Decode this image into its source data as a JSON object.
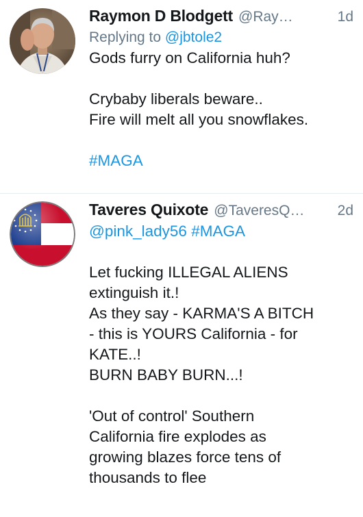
{
  "tweets": [
    {
      "display_name": "Raymon D Blodgett",
      "handle": "@Ray…",
      "time": "1d",
      "replying_to_prefix": "Replying to",
      "replying_to_handle": "@jbtole2",
      "lines": [
        "Gods furry on California huh?",
        "Crybaby liberals beware..",
        "Fire will melt all you snowflakes.",
        "#MAGA"
      ]
    },
    {
      "display_name": "Taveres Quixote",
      "handle": "@TaveresQ…",
      "time": "2d",
      "mention": "@pink_lady56",
      "hashtag": "#MAGA",
      "lines": [
        "Let fucking ILLEGAL ALIENS",
        "extinguish it.!",
        "As they say - KARMA'S A BITCH",
        "- this is YOURS California - for",
        "KATE..!",
        "BURN BABY BURN...!",
        "'Out of control' Southern",
        "California fire explodes as",
        "growing blazes force tens of",
        "thousands to flee"
      ]
    }
  ],
  "colors": {
    "link": "#1b95e0",
    "secondary_text": "#657786",
    "primary_text": "#14171a",
    "divider": "#e6ecf0"
  },
  "icons": {
    "avatar_1": "profile-photo",
    "avatar_2": "georgia-flag-badge"
  }
}
